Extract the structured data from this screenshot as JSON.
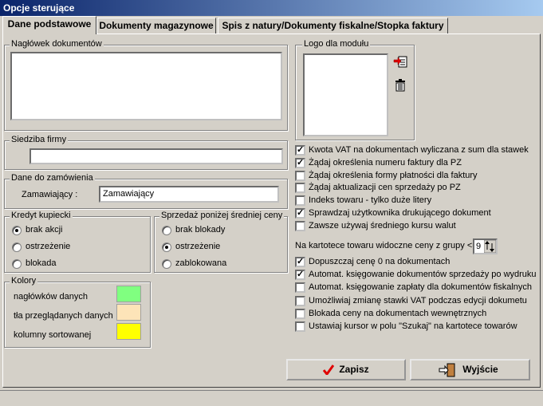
{
  "window": {
    "title": "Opcje sterujące"
  },
  "tabs": [
    {
      "label": "Dane podstawowe",
      "active": true
    },
    {
      "label": "Dokumenty magazynowe",
      "active": false
    },
    {
      "label": "Spis z natury/Dokumenty fiskalne/Stopka faktury",
      "active": false
    }
  ],
  "header_group": {
    "label": "Nagłówek dokumentów",
    "value": ""
  },
  "logo_group": {
    "label": "Logo dla modułu",
    "icons": [
      "add-logo-icon",
      "trash-icon"
    ]
  },
  "seat_group": {
    "label": "Siedziba firmy",
    "value": ""
  },
  "order_group": {
    "label": "Dane do zamówienia",
    "field_label": "Zamawiający :",
    "field_value": "Zamawiający"
  },
  "credit_group": {
    "label": "Kredyt kupiecki",
    "options": [
      {
        "label": "brak akcji",
        "selected": true
      },
      {
        "label": "ostrzeżenie",
        "selected": false
      },
      {
        "label": "blokada",
        "selected": false
      }
    ]
  },
  "price_group": {
    "label": "Sprzedaż poniżej średniej ceny",
    "options": [
      {
        "label": "brak blokady",
        "selected": false
      },
      {
        "label": "ostrzeżenie",
        "selected": true
      },
      {
        "label": "zablokowana",
        "selected": false
      }
    ]
  },
  "colors_group": {
    "label": "Kolory",
    "items": [
      {
        "label": "nagłówków danych",
        "color": "#80ff80"
      },
      {
        "label": "tła przeglądanych danych",
        "color": "#fde4b8"
      },
      {
        "label": "kolumny sortowanej",
        "color": "#ffff00"
      }
    ]
  },
  "options_top": [
    {
      "label": "Kwota VAT na dokumentach wyliczana z sum dla stawek",
      "checked": true
    },
    {
      "label": "Żądaj określenia numeru faktury dla PZ",
      "checked": true
    },
    {
      "label": "Żądaj określenia formy płatności dla faktury",
      "checked": false
    },
    {
      "label": "Żądaj aktualizacji cen sprzedaży po PZ",
      "checked": false
    },
    {
      "label": "Indeks towaru - tylko duże litery",
      "checked": false
    },
    {
      "label": "Sprawdzaj użytkownika drukującego dokument",
      "checked": true
    },
    {
      "label": "Zawsze używaj średniego kursu walut",
      "checked": false
    }
  ],
  "price_groups_row": {
    "label": "Na kartotece towaru widoczne ceny z grupy <=",
    "value": "9"
  },
  "options_bottom": [
    {
      "label": "Dopuszczaj cenę 0 na dokumentach",
      "checked": true
    },
    {
      "label": "Automat. księgowanie dokumentów sprzedaży po wydruku",
      "checked": true
    },
    {
      "label": "Automat. księgowanie zapłaty dla dokumentów fiskalnych",
      "checked": false
    },
    {
      "label": "Umożliwiaj zmianę stawki VAT podczas edycji dokumetu",
      "checked": false
    },
    {
      "label": "Blokada ceny na dokumentach wewnętrznych",
      "checked": false
    },
    {
      "label": "Ustawiaj kursor w polu \"Szukaj\" na kartotece towarów",
      "checked": false
    }
  ],
  "buttons": {
    "save": "Zapisz",
    "exit": "Wyjście"
  }
}
